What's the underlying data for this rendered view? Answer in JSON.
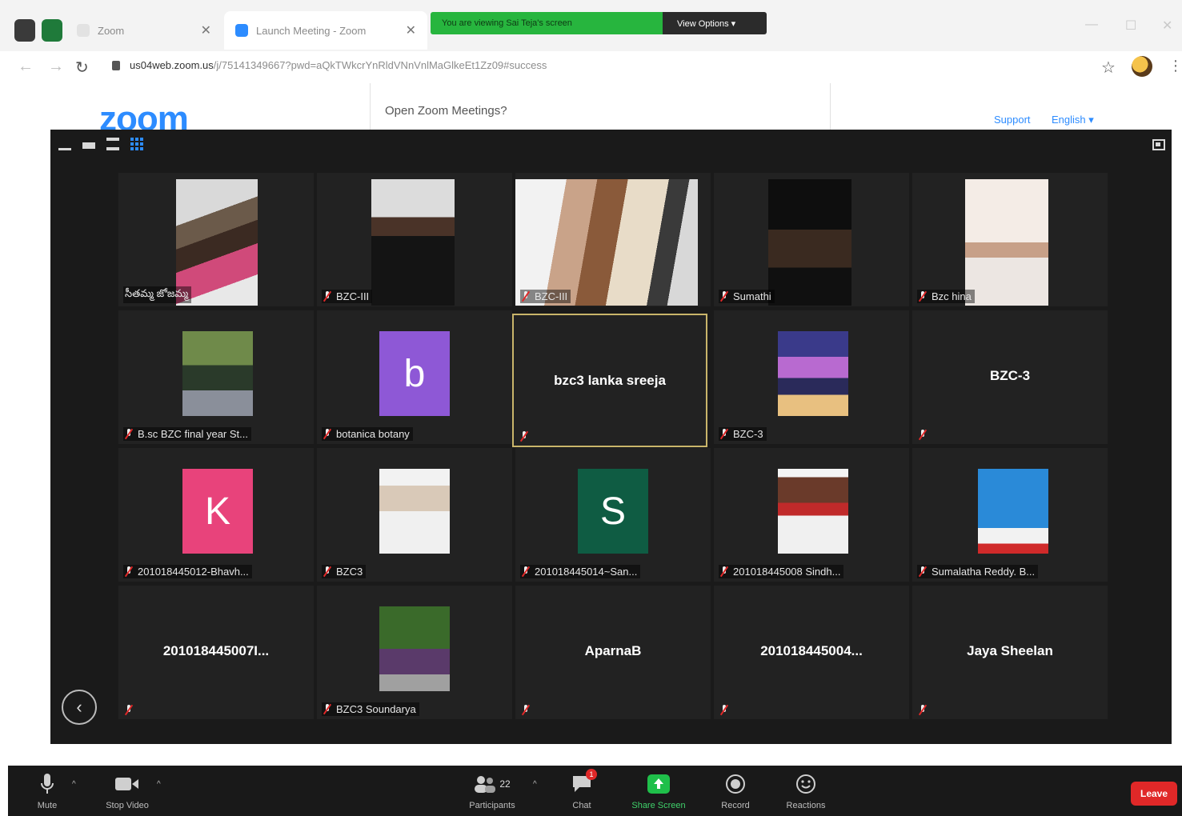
{
  "browser": {
    "tabs": [
      {
        "label": "Zoom"
      },
      {
        "label": "Launch Meeting - Zoom"
      }
    ],
    "sharing_banner": {
      "message": "You are viewing Sai Teja's screen",
      "options_label": "View Options ▾"
    },
    "url_host": "us04web.zoom.us",
    "url_path": "/j/75141349667?pwd=aQkTWkcrYnRldVNnVnlMaGlkeEt1Zz09#success"
  },
  "zoom_page": {
    "logo": "zoom",
    "dialog_title": "Open Zoom Meetings?",
    "support_link": "Support",
    "language_link": "English ▾"
  },
  "colors": {
    "accent": "#2d8cff",
    "leave": "#e02828",
    "active_speaker_border": "#c9b56a"
  },
  "participants": [
    {
      "name": "సీతమ్మ జోజమ్మ",
      "kind": "video"
    },
    {
      "name": "BZC-III",
      "kind": "video"
    },
    {
      "name": "BZC-III",
      "kind": "video"
    },
    {
      "name": "Sumathi",
      "kind": "video"
    },
    {
      "name": "Bzc hina",
      "kind": "video"
    },
    {
      "name": "B.sc BZC final year St...",
      "kind": "video"
    },
    {
      "name": "botanica botany",
      "kind": "avatar",
      "letter": "b",
      "color": "#8e58d6"
    },
    {
      "name": "bzc3 lanka sreeja",
      "kind": "name",
      "highlight": true
    },
    {
      "name": "BZC-3",
      "kind": "video"
    },
    {
      "name": "BZC-3",
      "kind": "name"
    },
    {
      "name": "20101844501​2-Bhavh...",
      "kind": "avatar",
      "letter": "K",
      "color": "#e8437b"
    },
    {
      "name": "BZC3",
      "kind": "video"
    },
    {
      "name": "201018445014~San...",
      "kind": "avatar",
      "letter": "S",
      "color": "#0f5c43"
    },
    {
      "name": "201018445008 Sindh...",
      "kind": "video"
    },
    {
      "name": "Sumalatha Reddy. B...",
      "kind": "video"
    },
    {
      "name": "201018445007I...",
      "kind": "name"
    },
    {
      "name": "BZC3 Soundarya",
      "kind": "video"
    },
    {
      "name": "AparnaB",
      "kind": "name"
    },
    {
      "name": "201018445004...",
      "kind": "name"
    },
    {
      "name": "Jaya Sheelan",
      "kind": "name"
    }
  ],
  "toolbar": {
    "mute": "Mute",
    "stop_video": "Stop Video",
    "participants": "Participants",
    "participants_count": "22",
    "chat": "Chat",
    "chat_badge": "1",
    "share_screen": "Share Screen",
    "record": "Record",
    "reactions": "Reactions",
    "leave": "Leave"
  }
}
